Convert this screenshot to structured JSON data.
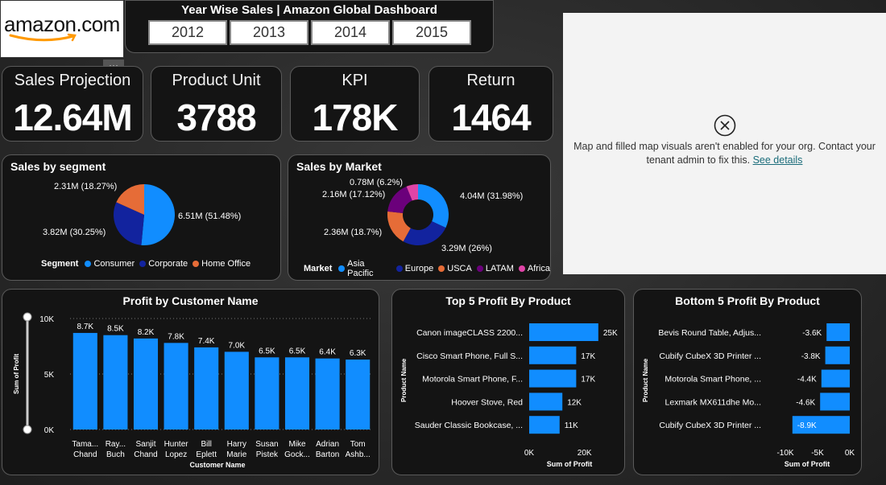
{
  "logo": {
    "text": "amazon.com"
  },
  "more_options_glyph": "···",
  "header": {
    "title": "Year Wise Sales | Amazon Global Dashboard",
    "years": [
      "2012",
      "2013",
      "2014",
      "2015"
    ]
  },
  "kpis": [
    {
      "label": "Sales Projection",
      "value": "12.64M"
    },
    {
      "label": "Product Unit",
      "value": "3788"
    },
    {
      "label": "KPI",
      "value": "178K"
    },
    {
      "label": "Return",
      "value": "1464"
    }
  ],
  "sales_by_segment": {
    "title": "Sales by segment",
    "legend_title": "Segment",
    "labels": [
      "6.51M (51.48%)",
      "3.82M (30.25%)",
      "2.31M (18.27%)"
    ]
  },
  "sales_by_market": {
    "title": "Sales by Market",
    "legend_title": "Market",
    "labels": [
      "4.04M (31.98%)",
      "3.29M (26%)",
      "2.36M (18.7%)",
      "2.16M (17.12%)",
      "0.78M (6.2%)"
    ]
  },
  "map": {
    "message": "Map and filled map visuals aren't enabled for your org. Contact your tenant admin to fix this.",
    "link_text": "See details",
    "icon": "close-circle-icon"
  },
  "colors": {
    "blue": "#118DFF",
    "navy": "#12239E",
    "orange": "#E66C37",
    "purple": "#6B007B",
    "pink": "#E044A7"
  },
  "chart_data": [
    {
      "type": "pie",
      "title": "Sales by segment",
      "legend_title": "Segment",
      "categories": [
        "Consumer",
        "Corporate",
        "Home Office"
      ],
      "values": [
        6.51,
        3.82,
        2.31
      ],
      "percentages": [
        51.48,
        30.25,
        18.27
      ],
      "unit": "M",
      "colors": [
        "#118DFF",
        "#12239E",
        "#E66C37"
      ],
      "legend_position": "bottom"
    },
    {
      "type": "pie",
      "variant": "donut",
      "title": "Sales by Market",
      "legend_title": "Market",
      "categories": [
        "Asia Pacific",
        "Europe",
        "USCA",
        "LATAM",
        "Africa"
      ],
      "values": [
        4.04,
        3.29,
        2.36,
        2.16,
        0.78
      ],
      "percentages": [
        31.98,
        26,
        18.7,
        17.12,
        6.2
      ],
      "unit": "M",
      "colors": [
        "#118DFF",
        "#12239E",
        "#E66C37",
        "#6B007B",
        "#E044A7"
      ],
      "legend_position": "bottom"
    },
    {
      "type": "bar",
      "title": "Profit by Customer Name",
      "xlabel": "Customer Name",
      "ylabel": "Sum of Profit",
      "categories": [
        [
          "Tama...",
          "Chand"
        ],
        [
          "Ray...",
          "Buch"
        ],
        [
          "Sanjit",
          "Chand"
        ],
        [
          "Hunter",
          "Lopez"
        ],
        [
          "Bill",
          "Eplett"
        ],
        [
          "Harry",
          "Marie"
        ],
        [
          "Susan",
          "Pistek"
        ],
        [
          "Mike",
          "Gock..."
        ],
        [
          "Adrian",
          "Barton"
        ],
        [
          "Tom",
          "Ashb..."
        ]
      ],
      "values": [
        8.7,
        8.5,
        8.2,
        7.8,
        7.4,
        7.0,
        6.5,
        6.5,
        6.4,
        6.3
      ],
      "data_labels": [
        "8.7K",
        "8.5K",
        "8.2K",
        "7.8K",
        "7.4K",
        "7.0K",
        "6.5K",
        "6.5K",
        "6.4K",
        "6.3K"
      ],
      "unit": "K",
      "yticks": [
        "0K",
        "5K",
        "10K"
      ],
      "ylim": [
        0,
        10
      ],
      "color": "#118DFF",
      "grid": true
    },
    {
      "type": "bar",
      "orientation": "horizontal",
      "title": "Top 5 Profit By Product",
      "xlabel": "Sum of Profit",
      "ylabel": "Product Name",
      "categories": [
        "Canon imageCLASS 2200...",
        "Cisco Smart Phone, Full S...",
        "Motorola Smart Phone, F...",
        "Hoover Stove, Red",
        "Sauder Classic Bookcase, ..."
      ],
      "values": [
        25,
        17,
        17,
        12,
        11
      ],
      "data_labels": [
        "25K",
        "17K",
        "17K",
        "12K",
        "11K"
      ],
      "unit": "K",
      "xticks": [
        "0K",
        "20K"
      ],
      "xlim": [
        0,
        30
      ],
      "color": "#118DFF"
    },
    {
      "type": "bar",
      "orientation": "horizontal",
      "title": "Bottom 5 Profit By Product",
      "xlabel": "Sum of Profit",
      "ylabel": "Product Name",
      "categories": [
        "Bevis Round Table, Adjus...",
        "Cubify CubeX 3D Printer ...",
        "Motorola Smart Phone, ...",
        "Lexmark MX611dhe Mo...",
        "Cubify CubeX 3D Printer ..."
      ],
      "values": [
        -3.6,
        -3.8,
        -4.4,
        -4.6,
        -8.9
      ],
      "data_labels": [
        "-3.6K",
        "-3.8K",
        "-4.4K",
        "-4.6K",
        "-8.9K"
      ],
      "unit": "K",
      "xticks": [
        "-10K",
        "-5K",
        "0K"
      ],
      "xlim": [
        -10,
        0
      ],
      "color": "#118DFF"
    }
  ]
}
